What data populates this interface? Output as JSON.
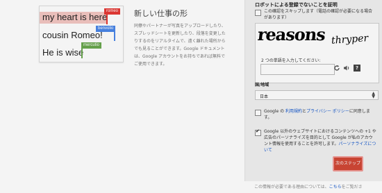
{
  "illustration": {
    "line1": "my heart is here",
    "line2": "cousin Romeo!",
    "line3": "He is wise",
    "tags": {
      "romeo": "romeo",
      "benvolio": "benvolio",
      "mercutio": "mercutio"
    },
    "colors": {
      "romeo": "#e53935",
      "benvolio": "#4a86e8",
      "mercutio": "#6aa84f"
    }
  },
  "feature": {
    "title": "新しい仕事の形",
    "description": "同僚やパートナーが写真をアップロードしたり、スプレッドシートを更新したり、段落を変更したりするのをリアルタイムで、遠く離れた場所からでも見ることができます。Google ドキュメントは、Google アカウントをお持ちであれば無料でご使用できます。"
  },
  "signup": {
    "robot_heading": "ロボットによる登録でないことを証明",
    "skip_label": "この確認をスキップします（電話の確認が必要になる場合があります）",
    "captcha": {
      "word1": "reasons",
      "word2": "thryper",
      "prompt": "2 つの単語を入力してください:",
      "input_value": "",
      "refresh_icon": "refresh-icon",
      "audio_icon": "audio-icon",
      "help_icon": "help-icon",
      "help_glyph": "?"
    },
    "country_label": "国/地域",
    "country_value": "日本",
    "terms": {
      "prefix": "Google の ",
      "terms_link": "利用規約",
      "and": "と",
      "privacy_link": "プライバシー ポリシー",
      "suffix": "に同意します。"
    },
    "personalize": {
      "text": "Google 以外のウェブサイトにおけるコンテンツへの +1 や広告のパーソナライズを目的として Google が私のアカウント情報を使用することを許可します。",
      "link": "パーソナライズについて"
    },
    "next_button": "次のステップ",
    "footer": {
      "text": "この情報が必要である理由については、",
      "link": "こちら",
      "suffix": "をご覧ださ"
    }
  }
}
